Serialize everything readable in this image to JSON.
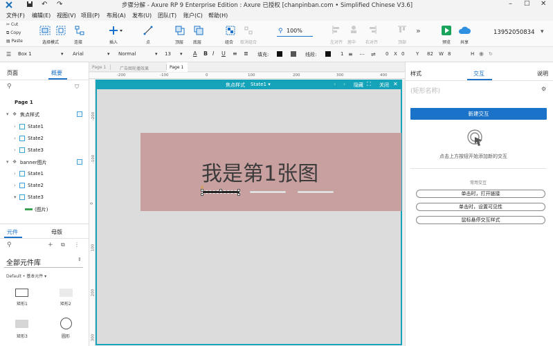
{
  "titlebar": {
    "title": "步骤分解 - Axure RP 9 Enterprise Edition : Axure 已授权    [chanpinban.com • Simplified Chinese V3.6]"
  },
  "menu": [
    "文件(F)",
    "编辑(E)",
    "视图(V)",
    "项目(P)",
    "布局(A)",
    "发布(U)",
    "团队(T)",
    "账户(C)",
    "帮助(H)"
  ],
  "clipboard": {
    "cut": "Cut",
    "copy": "Copy",
    "paste": "Paste"
  },
  "toolbar": {
    "select_mode": "选择模式",
    "connect": "连接",
    "insert": "插入",
    "point": "点",
    "top": "顶层",
    "bottom": "底层",
    "group": "组合",
    "ungroup": "取消组合",
    "zoom": "100%",
    "left": "左对齐",
    "center": "居中",
    "right": "右对齐",
    "top_align": "顶部",
    "preview": "预览",
    "share": "共享",
    "user": "13952050834"
  },
  "format": {
    "style": "Box 1",
    "font": "Arial",
    "weight": "Normal",
    "size": "13",
    "fill_label": "填充:",
    "line_label": "线段:",
    "line_value": "1",
    "x_label": "X",
    "x": "0",
    "y_label": "Y",
    "y": "0",
    "w_label": "W",
    "w": "82",
    "h_label": "H",
    "h": "8"
  },
  "left": {
    "tab_pages": "页面",
    "tab_outline": "概要",
    "tree": {
      "page": "Page 1",
      "focus_dp": "焦点样式",
      "focus_states": [
        "State1",
        "State2",
        "State3"
      ],
      "banner_dp": "banner图片",
      "banner_states": [
        "State1",
        "State2",
        "State3"
      ],
      "image_item": "(图片)"
    },
    "tab_widgets": "元件",
    "tab_masters": "母版",
    "library": "全部元件库",
    "lib_path": "Default • 基本元件 ▾",
    "widgets": [
      "矩形1",
      "矩形2",
      "矩形3",
      "圆形"
    ]
  },
  "doc_tabs": [
    "Page 1",
    "广告图轮播效果",
    "Page 1"
  ],
  "ruler": {
    "h": [
      "-200",
      "-100",
      "0",
      "100",
      "200",
      "300",
      "400"
    ],
    "v": [
      "-200",
      "-100",
      "0",
      "100",
      "200",
      "300"
    ]
  },
  "editor": {
    "title": "焦点样式",
    "state": "State1 ▾",
    "hide": "隐藏",
    "close": "关闭"
  },
  "banner_text": "我是第1张图",
  "right": {
    "tab_style": "样式",
    "tab_interact": "交互",
    "tab_notes": "说明",
    "name_placeholder": "(矩形名称)",
    "new_interaction": "新建交互",
    "hint": "点击上方按钮开始添加新的交互",
    "common_title": "常用交互",
    "common": [
      "单击时，打开链接",
      "单击时，设置可见性",
      "鼠标悬停交互样式"
    ]
  },
  "colors": {
    "teal": "#14a3b8",
    "banner": "#c9a0a0",
    "primary": "#1a73c9"
  }
}
